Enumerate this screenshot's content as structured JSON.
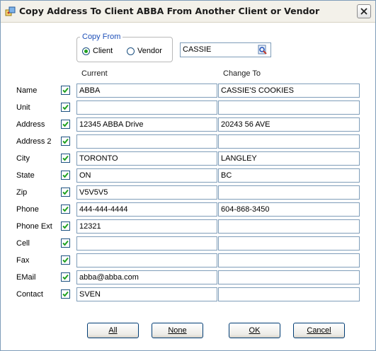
{
  "window": {
    "title": "Copy Address To Client ABBA From Another Client or Vendor"
  },
  "copy_from": {
    "legend": "Copy From",
    "options": [
      {
        "label": "Client",
        "selected": true
      },
      {
        "label": "Vendor",
        "selected": false
      }
    ]
  },
  "search": {
    "value": "CASSIE"
  },
  "columns": {
    "current": "Current",
    "change_to": "Change To"
  },
  "rows": [
    {
      "label": "Name",
      "checked": true,
      "current": "ABBA",
      "change_to": "CASSIE'S COOKIES"
    },
    {
      "label": "Unit",
      "checked": true,
      "current": "",
      "change_to": ""
    },
    {
      "label": "Address",
      "checked": true,
      "current": "12345 ABBA Drive",
      "change_to": "20243 56 AVE"
    },
    {
      "label": "Address 2",
      "checked": true,
      "current": "",
      "change_to": ""
    },
    {
      "label": "City",
      "checked": true,
      "current": "TORONTO",
      "change_to": "LANGLEY"
    },
    {
      "label": "State",
      "checked": true,
      "current": "ON",
      "change_to": "BC"
    },
    {
      "label": "Zip",
      "checked": true,
      "current": "V5V5V5",
      "change_to": ""
    },
    {
      "label": "Phone",
      "checked": true,
      "current": "444-444-4444",
      "change_to": "604-868-3450"
    },
    {
      "label": "Phone Ext",
      "checked": true,
      "current": "12321",
      "change_to": ""
    },
    {
      "label": "Cell",
      "checked": true,
      "current": "",
      "change_to": ""
    },
    {
      "label": "Fax",
      "checked": true,
      "current": "",
      "change_to": ""
    },
    {
      "label": "EMail",
      "checked": true,
      "current": "abba@abba.com",
      "change_to": ""
    },
    {
      "label": "Contact",
      "checked": true,
      "current": "SVEN",
      "change_to": ""
    }
  ],
  "buttons": {
    "all": "All",
    "none": "None",
    "ok": "OK",
    "cancel": "Cancel"
  },
  "colors": {
    "accent": "#1d4fb8",
    "check": "#21a121",
    "border": "#7f9db9"
  },
  "icons": {
    "title": "copy-address-icon",
    "close": "close-icon",
    "search": "search-icon",
    "checkbox": "checkmark-icon"
  }
}
